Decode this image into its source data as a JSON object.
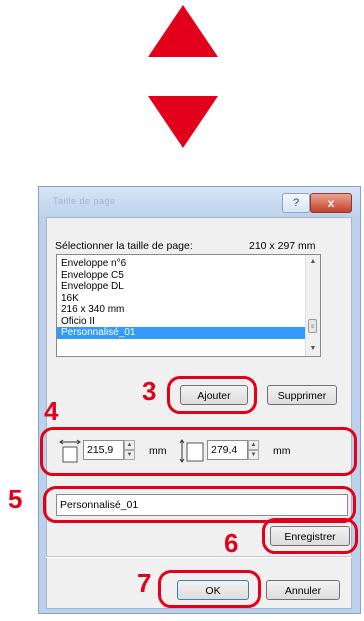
{
  "arrows": {
    "color": "#e3001b"
  },
  "dialog": {
    "title": "Taille de page",
    "help_label": "?",
    "close_label": "x",
    "size_label": "Sélectionner la taille de page:",
    "size_value": "210 x 297 mm",
    "list_items": [
      "Enveloppe n°6",
      "Enveloppe C5",
      "Enveloppe DL",
      "16K",
      "216 x 340 mm",
      "Oficio II",
      "Personnalisé_01"
    ],
    "selected_item": "Personnalisé_01",
    "add_button": "Ajouter",
    "delete_button": "Supprimer",
    "width_value": "215,9",
    "height_value": "279,4",
    "unit": "mm",
    "name_value": "Personnalisé_01",
    "save_button": "Enregistrer",
    "ok_button": "OK",
    "cancel_button": "Annuler"
  },
  "callouts": {
    "step3": "3",
    "step4": "4",
    "step5": "5",
    "step6": "6",
    "step7": "7"
  },
  "icons": {
    "arrow_up": "triangle-up-icon",
    "arrow_down": "triangle-down-icon",
    "width": "width-dimension-icon",
    "height": "height-dimension-icon"
  }
}
